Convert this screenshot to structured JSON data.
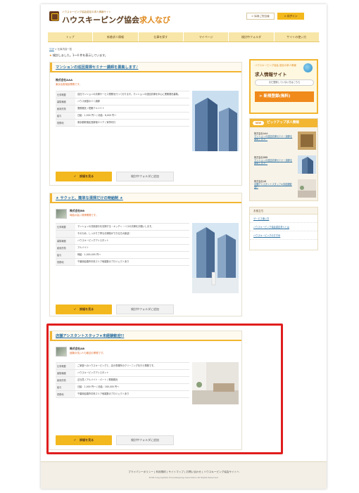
{
  "header": {
    "tagline": "ハウスキーピング協会認定の求人情報サイト",
    "logo_main": "ハウスキーピング協会",
    "logo_accent": "求人なび",
    "btn_company": "> 採用ご担当者",
    "btn_login": "> ログイン"
  },
  "nav": [
    "トップ",
    "新着求人情報",
    "仕事を探す",
    "マイページ",
    "検討中フォルダ",
    "サイトの使い方"
  ],
  "breadcrumb": {
    "home": "TOP",
    "current": "> 仕事内容一覧"
  },
  "result_text": "検討しました。1～4 件を表示しています。",
  "jobs": [
    {
      "title": "マンションの巡回清掃セミナー講師を募集します♪",
      "company": "株式会社AAA",
      "sub": "東京出張相談業務です。",
      "rows": [
        {
          "h": "仕事概要",
          "v": "自社マンションの清掃サービス業務を行っております。マンションの巡回清掃を中心に業務委託募集。"
        },
        {
          "h": "募集職種",
          "v": "ハウス家庭のミニ講師"
        },
        {
          "h": "雇用形態",
          "v": "業務委託 / 短期アルバイト"
        },
        {
          "h": "給与",
          "v": "日給：1,500 円～ / 月給：8,000 円～"
        },
        {
          "h": "勤務地",
          "v": "東京都新宿区西新宿エリア / 家事代行"
        }
      ],
      "btn_detail": "詳細を見る",
      "btn_fav": "検討中フォルダに追加"
    },
    {
      "title": "★ サクッと、簡単な清掃だけの時給制 ★",
      "company": "株式会社BB",
      "sub": "時給の高い清掃業務です。",
      "rows": [
        {
          "h": "仕事概要",
          "v": "マンションの共用部分を清掃する・キッチン・バスの清掃をお願いします。"
        },
        {
          "h": "",
          "v": "そのため、しっかり丁寧なお掃除ができる方大歓迎！"
        },
        {
          "h": "募集職種",
          "v": "ハウスキーピングアシスタント"
        },
        {
          "h": "雇用形態",
          "v": "アルバイト"
        },
        {
          "h": "給与",
          "v": "時給：1,000,000 円～"
        },
        {
          "h": "勤務地",
          "v": "千葉県船橋市中央エリア他複数のプロジェクトあり"
        }
      ],
      "btn_detail": "詳細を見る",
      "btn_fav": "検討中フォルダに追加"
    },
    {
      "title": "店舗アシスタントスタッフ★未経験歓迎!!",
      "company": "株式会社AB",
      "sub": "経験の浅い人も歓迎の業務です。",
      "rows": [
        {
          "h": "仕事概要",
          "v": "ご家庭へのハウスキーピングと、店の事務所のクリーニングを行う業務です。"
        },
        {
          "h": "募集職種",
          "v": "ハウスキーピングアシスタント"
        },
        {
          "h": "雇用形態",
          "v": "正社員 / アルバイト・パート / 業務委託"
        },
        {
          "h": "給与",
          "v": "日給：1,000 円～ / 月給：180,000 円～"
        },
        {
          "h": "勤務地",
          "v": "千葉県船橋市中央エリア他複数のプロジェクトあり"
        }
      ],
      "btn_detail": "詳細を見る",
      "btn_fav": "検討中フォルダに追加"
    }
  ],
  "sidebar": {
    "register_tag": "ハウスキーピング協会 認定の求人情報",
    "register_title": "求人情報サイト",
    "register_note": "まだ登録していない方はこちら",
    "register_btn": "> 新規登録(無料)",
    "pickup_new": "NEW",
    "pickup_title": "ピックアップ求人情報",
    "pickups": [
      {
        "name": "株式会社AAA",
        "link": "マンションの巡回清掃セミナー講師を募集します！"
      },
      {
        "name": "株式会社BBB",
        "link": "マンションの巡回清掃セミナー講師を募集します！"
      },
      {
        "name": "株式会社AB",
        "link": "店舗アシスタントスタッフ★未経験歓迎!!"
      }
    ],
    "links_title": "お役立ち",
    "links": [
      "サービス使い方",
      "ハウスキーピング協会認定求人とは",
      "ハウスキーピングのすすめ"
    ]
  },
  "footer": {
    "links": "プライバシーポリシー | 利用規約 | サイトマップ | お問い合わせ | ハウスキーピング協会サイトへ",
    "copyright": "2018 Copyright(C) Housekeeping Association All Rights Reserved."
  },
  "colors": {
    "accent": "#f3b81d",
    "brand": "#5a3b1e",
    "link": "#2a6fa0",
    "highlight": "#e01d1d"
  }
}
